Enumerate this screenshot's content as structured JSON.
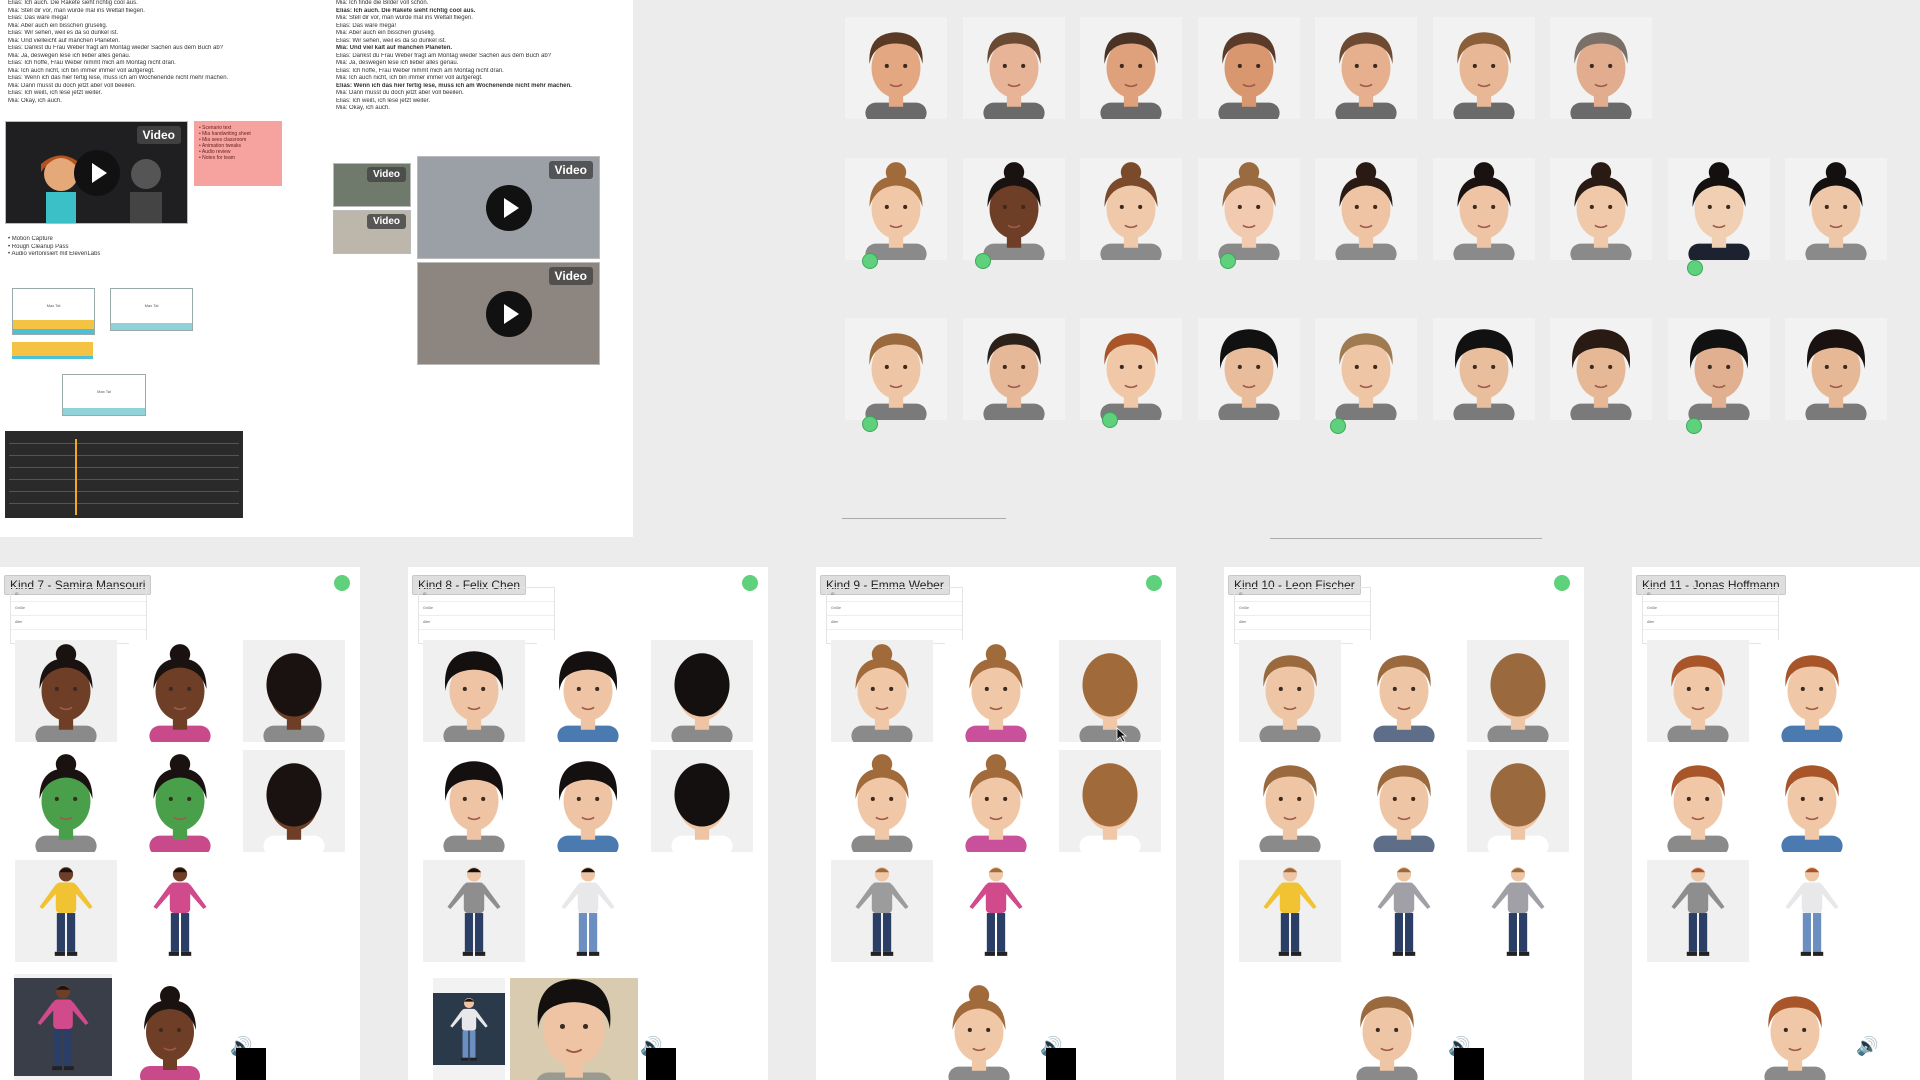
{
  "doc_left": {
    "lines": [
      "Elias: Ich auch. Die Rakete sieht richtig cool aus.",
      "Mia: Stell dir vor, man würde mal ins Weltall fliegen.",
      "Elias: Das wäre mega!",
      "Mia: Aber auch ein bisschen gruselig.",
      "Elias: Wir sehen, weil es da so dunkel ist.",
      "Mia: Und vielleicht auf manchen Planeten.",
      "Elias: Dankst du Frau Weber fragt am Montag wieder Sachen aus dem Buch ab?",
      "Mia: Ja, deswegen lese ich lieber alles genau.",
      "Elias: Ich hoffe, Frau Weber nimmt mich am Montag nicht dran.",
      "Mia: Ich auch nicht, ich bin immer immer voll aufgeregt.",
      "Elias: Wenn ich das hier fertig lese, muss ich am Wochenende nicht mehr machen.",
      "Mia: Dann musst du doch jetzt aber voll beeilen.",
      "Elias: Ich weiß, ich lese jetzt weiter.",
      "Mia: Okay, ich auch."
    ],
    "video_label": "Video",
    "bullets": [
      "Motion Capture",
      "Rough Cleanup Pass",
      "Audio vertonisiert mit ElevenLabs"
    ],
    "mini_windows": [
      "Max Tal",
      "Max Tal",
      "Max Tal"
    ]
  },
  "doc_mid": {
    "lines": [
      "Mia: Ich finde die Bilder voll schön.",
      "Elias: Ich auch. Die Rakete sieht richtig cool aus.",
      "",
      "Mia: Stell dir vor, man würde mal ins Weltall fliegen.",
      "Elias: Das wäre mega!",
      "Mia: Aber auch ein bisschen gruselig.",
      "Elias: Wir sehen, weil es da so dunkel ist.",
      "Mia: Und viel kalt auf manchen Planeten.",
      "",
      "Elias: Dankst du Frau Weber fragt am Montag wieder Sachen aus dem Buch ab?",
      "Mia: Ja, deswegen lese ich lieber alles genau.",
      "Elias: Ich hoffe, Frau Weber nimmt mich am Montag nicht dran.",
      "Mia: Ich auch nicht, ich bin immer immer voll aufgeregt.",
      "",
      "Elias: Wenn ich das hier fertig lese, muss ich am Wochenende nicht mehr machen.",
      "Mia: Dann musst du doch jetzt aber voll beeilen.",
      "Elias: Ich weiß, ich lese jetzt weiter.",
      "Mia: Okay, ich auch."
    ],
    "video_label": "Video"
  },
  "cards": [
    {
      "title": "Kind 7 - Samira Mansouri",
      "info": [
        "ID",
        "Größe",
        "Alter"
      ]
    },
    {
      "title": "Kind 8 - Felix Chen",
      "info": [
        "ID",
        "Größe",
        "Alter"
      ]
    },
    {
      "title": "Kind 9 - Emma Weber",
      "info": [
        "ID",
        "Größe",
        "Alter"
      ]
    },
    {
      "title": "Kind 10 - Leon Fischer",
      "info": [
        "ID",
        "Größe",
        "Alter"
      ]
    },
    {
      "title": "Kind 11 - Jonas Hoffmann",
      "info": [
        "ID",
        "Größe",
        "Alter"
      ]
    }
  ],
  "icons": {
    "play": "play-icon",
    "speaker": "speaker-icon",
    "status": "status-dot-icon",
    "cursor": "cursor-icon"
  },
  "colors": {
    "status_green": "#5fd17c",
    "sticky": "#f6a3a0",
    "canvas": "#ececec"
  }
}
